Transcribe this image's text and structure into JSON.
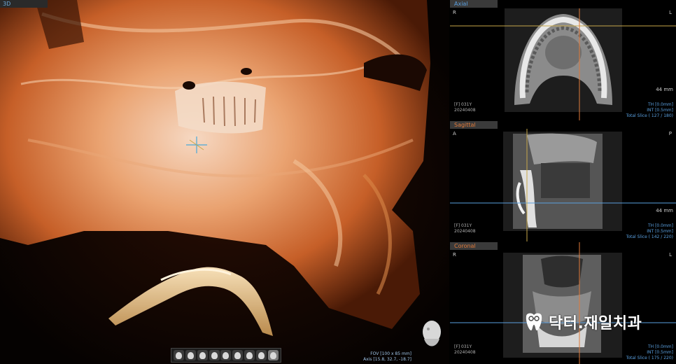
{
  "main_view": {
    "label": "3D"
  },
  "fov_info": {
    "line1": "FOV [100 x 85 mm]",
    "line2": "Axis [15.8, 32.7, -18.7]"
  },
  "axial": {
    "label": "Axial",
    "left": "R",
    "right": "L",
    "mm": "44 mm",
    "patient": "[F] 031Y",
    "date": "20240408",
    "th": "TH [0.0mm]",
    "int": "INT [0.5mm]",
    "slice": "Total Slice ( 127 / 180)"
  },
  "sagittal": {
    "label": "Sagittal",
    "left": "A",
    "right": "P",
    "mm": "44 mm",
    "patient": "[F] 031Y",
    "date": "20240408",
    "th": "TH [0.0mm]",
    "int": "INT [0.5mm]",
    "slice": "Total Slice ( 142 / 220)"
  },
  "coronal": {
    "label": "Coronal",
    "left": "R",
    "right": "L",
    "patient": "[F] 031Y",
    "date": "20240408",
    "th": "TH [0.0mm]",
    "int": "INT [0.5mm]",
    "slice": "Total Slice ( 175 / 220)"
  },
  "brand": {
    "name": "닥터.재일치과"
  },
  "toolbar": {
    "icons": [
      "head-front-icon",
      "head-back-icon",
      "head-left-icon",
      "head-right-icon",
      "head-top-icon",
      "head-bottom-icon",
      "head-oblique-icon",
      "head-reset-icon",
      "head-selected-icon"
    ]
  },
  "colors": {
    "accent_orange": "#e07a3a",
    "accent_blue": "#5aa0e0",
    "crosshair_yellow": "#c8a84a"
  }
}
